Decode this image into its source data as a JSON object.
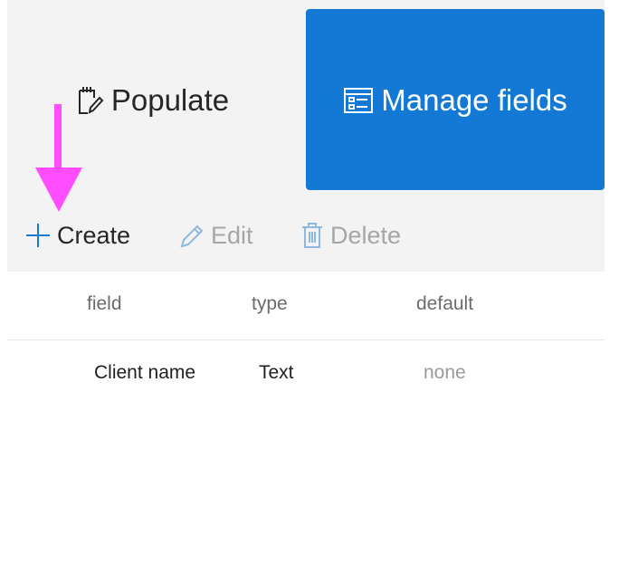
{
  "tabs": [
    {
      "label": "Populate",
      "icon": "notepad-pencil-icon",
      "active": false
    },
    {
      "label": "Manage fields",
      "icon": "form-list-icon",
      "active": true
    }
  ],
  "toolbar": {
    "create_label": "Create",
    "edit_label": "Edit",
    "delete_label": "Delete"
  },
  "table": {
    "columns": [
      "field",
      "type",
      "default"
    ],
    "rows": [
      {
        "field": "Client name",
        "type": "Text",
        "default": "none"
      }
    ]
  },
  "colors": {
    "accent": "#1479d4",
    "annotation_arrow": "#ff4dff",
    "panel_bg": "#f3f3f3",
    "disabled_text": "#a6a6a6"
  }
}
